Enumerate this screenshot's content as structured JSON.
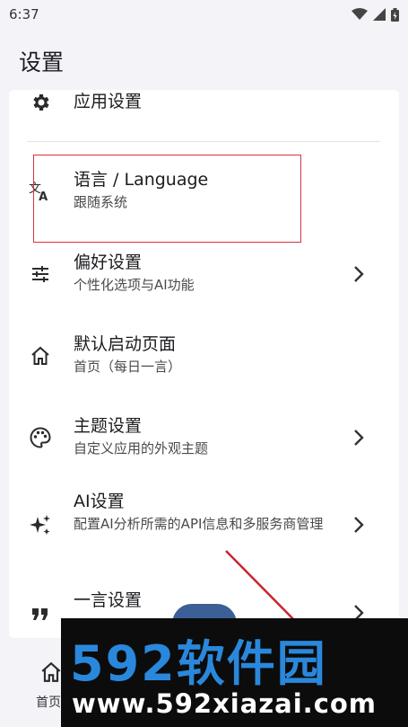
{
  "status_bar": {
    "time": "6:37"
  },
  "app_bar": {
    "title": "设置"
  },
  "settings": {
    "app_settings": {
      "title": "应用设置"
    },
    "language": {
      "title": "语言 / Language",
      "subtitle": "跟随系统"
    },
    "preferences": {
      "title": "偏好设置",
      "subtitle": "个性化选项与AI功能"
    },
    "default_page": {
      "title": "默认启动页面",
      "subtitle": "首页（每日一言）"
    },
    "theme": {
      "title": "主题设置",
      "subtitle": "自定义应用的外观主题"
    },
    "ai": {
      "title": "AI设置",
      "subtitle": "配置AI分析所需的API信息和多服务商管理"
    },
    "hitokoto": {
      "title": "一言设置"
    }
  },
  "bottom_nav": {
    "home_label": "首页"
  },
  "watermark": {
    "brand": "592软件园",
    "url": "www.592xiazai.com"
  },
  "colors": {
    "accent": "#3b5f96",
    "highlight": "#d9333e",
    "watermark_blue": "#2a88dc"
  }
}
